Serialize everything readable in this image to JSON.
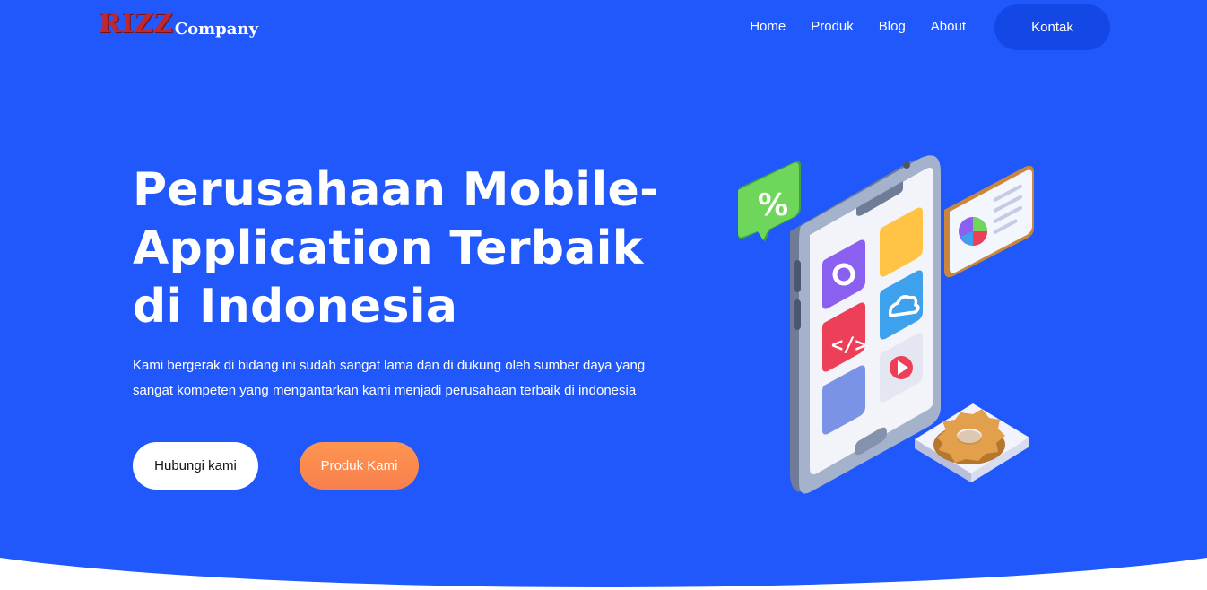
{
  "brand": {
    "name_primary": "RIZZ",
    "name_secondary": "Company"
  },
  "nav": {
    "items": [
      {
        "label": "Home"
      },
      {
        "label": "Produk"
      },
      {
        "label": "Blog"
      },
      {
        "label": "About"
      }
    ],
    "cta_label": "Kontak"
  },
  "hero": {
    "title": "Perusahaan Mobile-Application Terbaik di Indonesia",
    "description": "Kami bergerak di bidang ini sudah sangat lama dan di dukung oleh sumber daya yang sangat kompeten yang mengantarkan kami menjadi perusahaan terbaik di indonesia",
    "primary_button": "Hubungi kami",
    "secondary_button": "Produk Kami"
  },
  "illustration": {
    "badge_symbol": "%",
    "icons": [
      "percent-badge-icon",
      "settings-gear-icon",
      "code-icon",
      "cloud-icon",
      "play-icon",
      "pie-chart-card-icon",
      "gear-platform-icon"
    ]
  },
  "colors": {
    "background": "#2158fc",
    "nav_cta": "#1348e6",
    "accent_orange": "#f7804e",
    "logo_red": "#c1272d"
  }
}
